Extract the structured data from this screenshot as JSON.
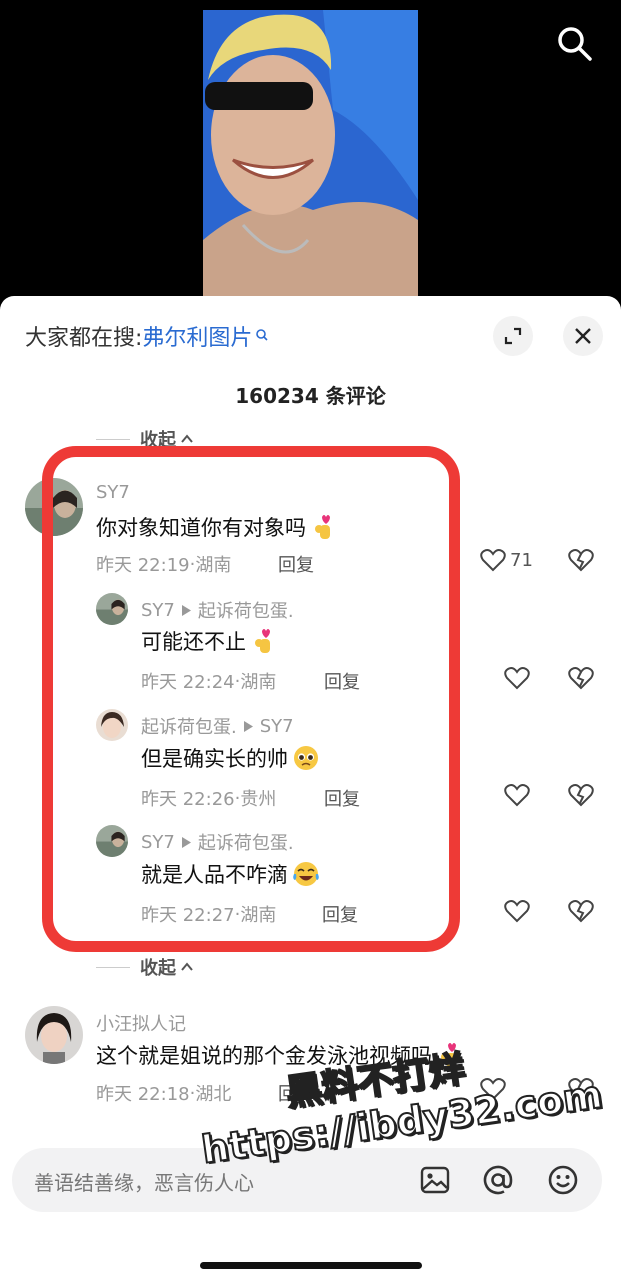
{
  "hot_search": {
    "prefix": "大家都在搜:",
    "keyword": "弗尔利图片"
  },
  "comment_count": "160234 条评论",
  "collapse_label": "收起",
  "comments": [
    {
      "user": "SY7",
      "text": "你对象知道你有对象吗",
      "time": "昨天 22:19",
      "location": "湖南",
      "reply_label": "回复",
      "likes": "71"
    },
    {
      "user": "小汪拟人记",
      "text": "这个就是姐说的那个金发泳池视频吗",
      "time": "昨天 22:18",
      "location": "湖北",
      "reply_label": "回复"
    }
  ],
  "replies": [
    {
      "user": "SY7",
      "to": "起诉荷包蛋.",
      "text": "可能还不止",
      "time": "昨天 22:24",
      "location": "湖南",
      "reply_label": "回复"
    },
    {
      "user": "起诉荷包蛋.",
      "to": "SY7",
      "text": "但是确实长的帅",
      "time": "昨天 22:26",
      "location": "贵州",
      "reply_label": "回复"
    },
    {
      "user": "SY7",
      "to": "起诉荷包蛋.",
      "text": "就是人品不咋滴",
      "time": "昨天 22:27",
      "location": "湖南",
      "reply_label": "回复"
    }
  ],
  "input": {
    "placeholder": "善语结善缘，恶言伤人心"
  },
  "watermark": {
    "line1": "黑料不打烊",
    "line2": "https://ibdy32.com"
  },
  "colors": {
    "highlight": "#ee3a36",
    "link": "#2a6bd1"
  },
  "icons": [
    "search-icon",
    "expand-icon",
    "close-icon",
    "chevron-up-icon",
    "heart-icon",
    "broken-heart-icon",
    "image-icon",
    "at-icon",
    "emoji-icon"
  ]
}
